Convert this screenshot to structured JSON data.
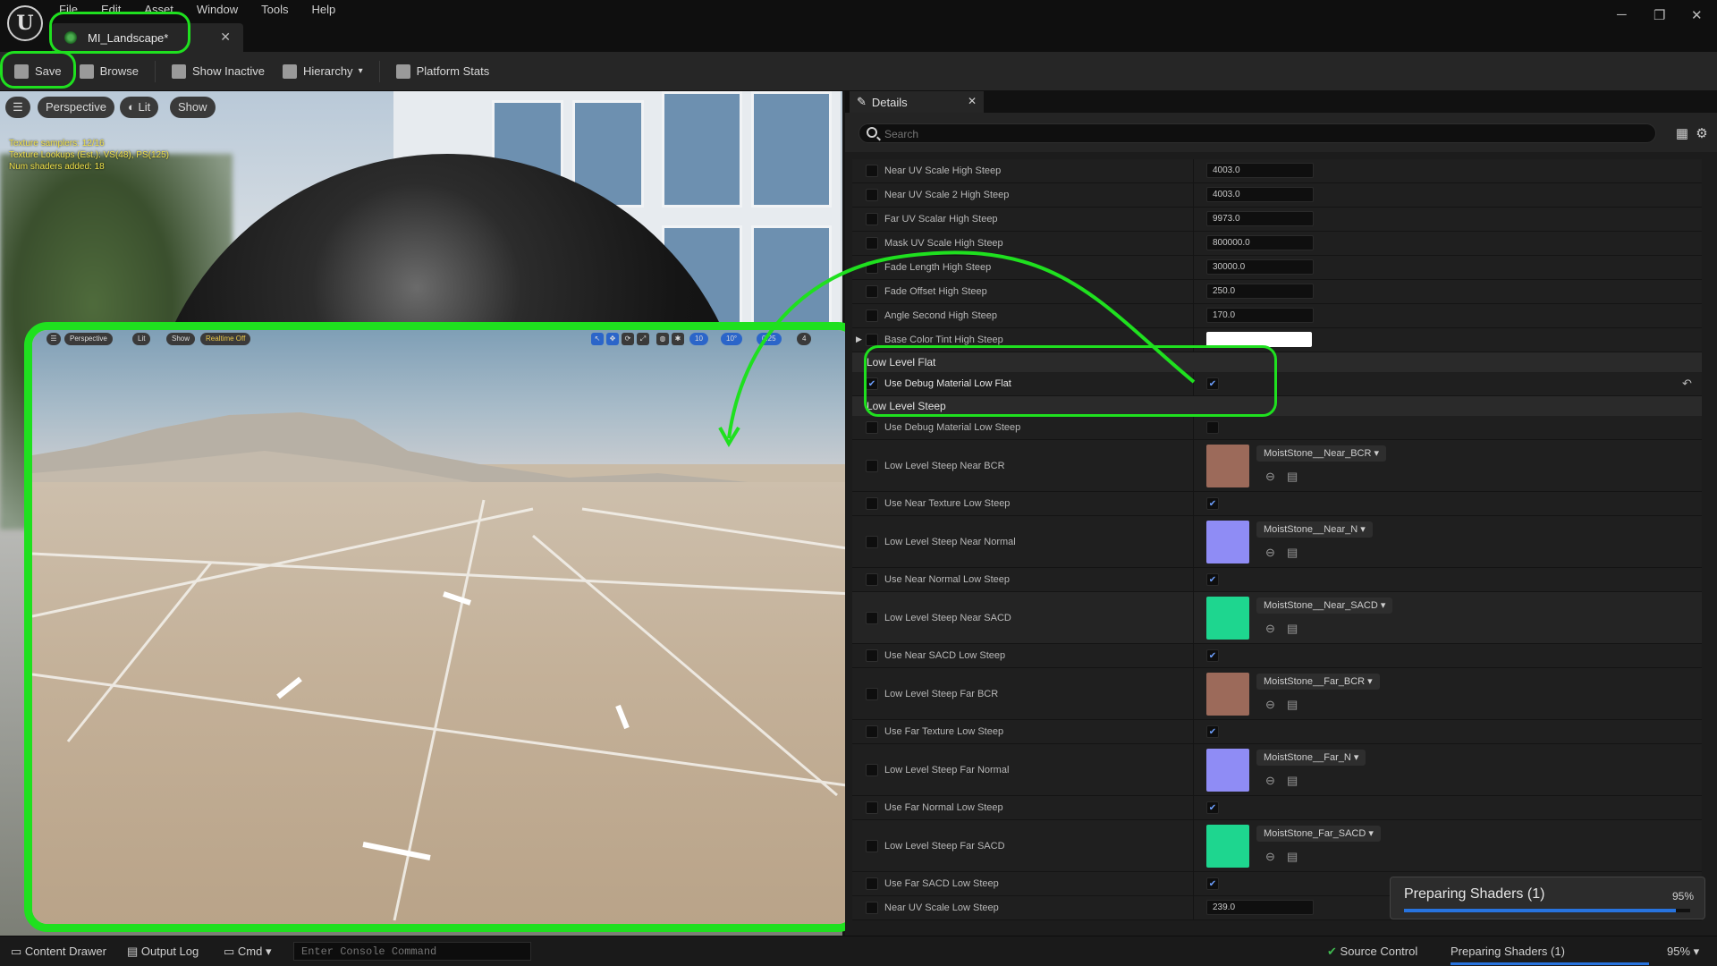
{
  "menu": [
    "File",
    "Edit",
    "Asset",
    "Window",
    "Tools",
    "Help"
  ],
  "tab": {
    "title": "MI_Landscape*"
  },
  "toolbar": {
    "save": "Save",
    "browse": "Browse",
    "show_inactive": "Show Inactive",
    "hierarchy": "Hierarchy",
    "platform_stats": "Platform Stats"
  },
  "viewport": {
    "perspective": "Perspective",
    "lit": "Lit",
    "show": "Show",
    "stats": [
      "Texture samplers: 12/16",
      "Texture Lookups (Est.): VS(48), PS(125)",
      "Num shaders added: 18"
    ]
  },
  "inset": {
    "perspective": "Perspective",
    "lit": "Lit",
    "show": "Show",
    "realtime": "Realtime Off",
    "grid": "10",
    "angle": "10°",
    "scale": "0.25",
    "camera": "4"
  },
  "details": {
    "tab": "Details",
    "search_placeholder": "Search",
    "rows_top": [
      {
        "name": "Near UV Scale High Steep",
        "value": "4003.0"
      },
      {
        "name": "Near UV Scale 2 High Steep",
        "value": "4003.0"
      },
      {
        "name": "Far UV Scalar High Steep",
        "value": "9973.0"
      },
      {
        "name": "Mask UV Scale High Steep",
        "value": "800000.0"
      },
      {
        "name": "Fade Length High Steep",
        "value": "30000.0"
      },
      {
        "name": "Fade Offset High Steep",
        "value": "250.0"
      },
      {
        "name": "Angle Second High Steep",
        "value": "170.0"
      },
      {
        "name": "Base Color Tint High Steep",
        "value": ""
      }
    ],
    "cat_low_flat": "Low Level Flat",
    "use_debug_low_flat": "Use Debug Material Low Flat",
    "cat_low_steep": "Low Level Steep",
    "use_debug_low_steep": "Use Debug Material Low Steep",
    "steep_rows": [
      {
        "name": "Low Level Steep Near BCR",
        "asset": "MoistStone__Near_BCR",
        "color": "#9c6a5a"
      },
      {
        "name": "Use Near Texture Low Steep"
      },
      {
        "name": "Low Level Steep Near Normal",
        "asset": "MoistStone__Near_N",
        "color": "#8f8cf5"
      },
      {
        "name": "Use Near  Normal Low Steep"
      },
      {
        "name": "Low Level Steep Near SACD",
        "asset": "MoistStone__Near_SACD",
        "color": "#1ed68f"
      },
      {
        "name": "Use Near  SACD Low Steep"
      },
      {
        "name": "Low Level Steep Far BCR",
        "asset": "MoistStone__Far_BCR",
        "color": "#9c6a5a"
      },
      {
        "name": "Use Far Texture Low Steep"
      },
      {
        "name": "Low Level Steep Far Normal",
        "asset": "MoistStone__Far_N",
        "color": "#8f8cf5"
      },
      {
        "name": "Use Far  Normal Low Steep"
      },
      {
        "name": "Low Level Steep Far SACD",
        "asset": "MoistStone_Far_SACD",
        "color": "#1ed68f"
      },
      {
        "name": "Use Far  SACD Low Steep"
      }
    ],
    "last_row": {
      "name": "Near UV Scale Low Steep",
      "value": "239.0"
    }
  },
  "notification": {
    "title": "Preparing Shaders (1)",
    "percent": "95%",
    "progress": 0.95
  },
  "statusbar": {
    "content_drawer": "Content Drawer",
    "output_log": "Output Log",
    "cmd": "Cmd",
    "console_placeholder": "Enter Console Command",
    "source_control": "Source Control",
    "preparing": "Preparing Shaders (1)",
    "percent": "95%"
  },
  "colors": {
    "annotation": "#1fe01f",
    "accent": "#2773de"
  }
}
